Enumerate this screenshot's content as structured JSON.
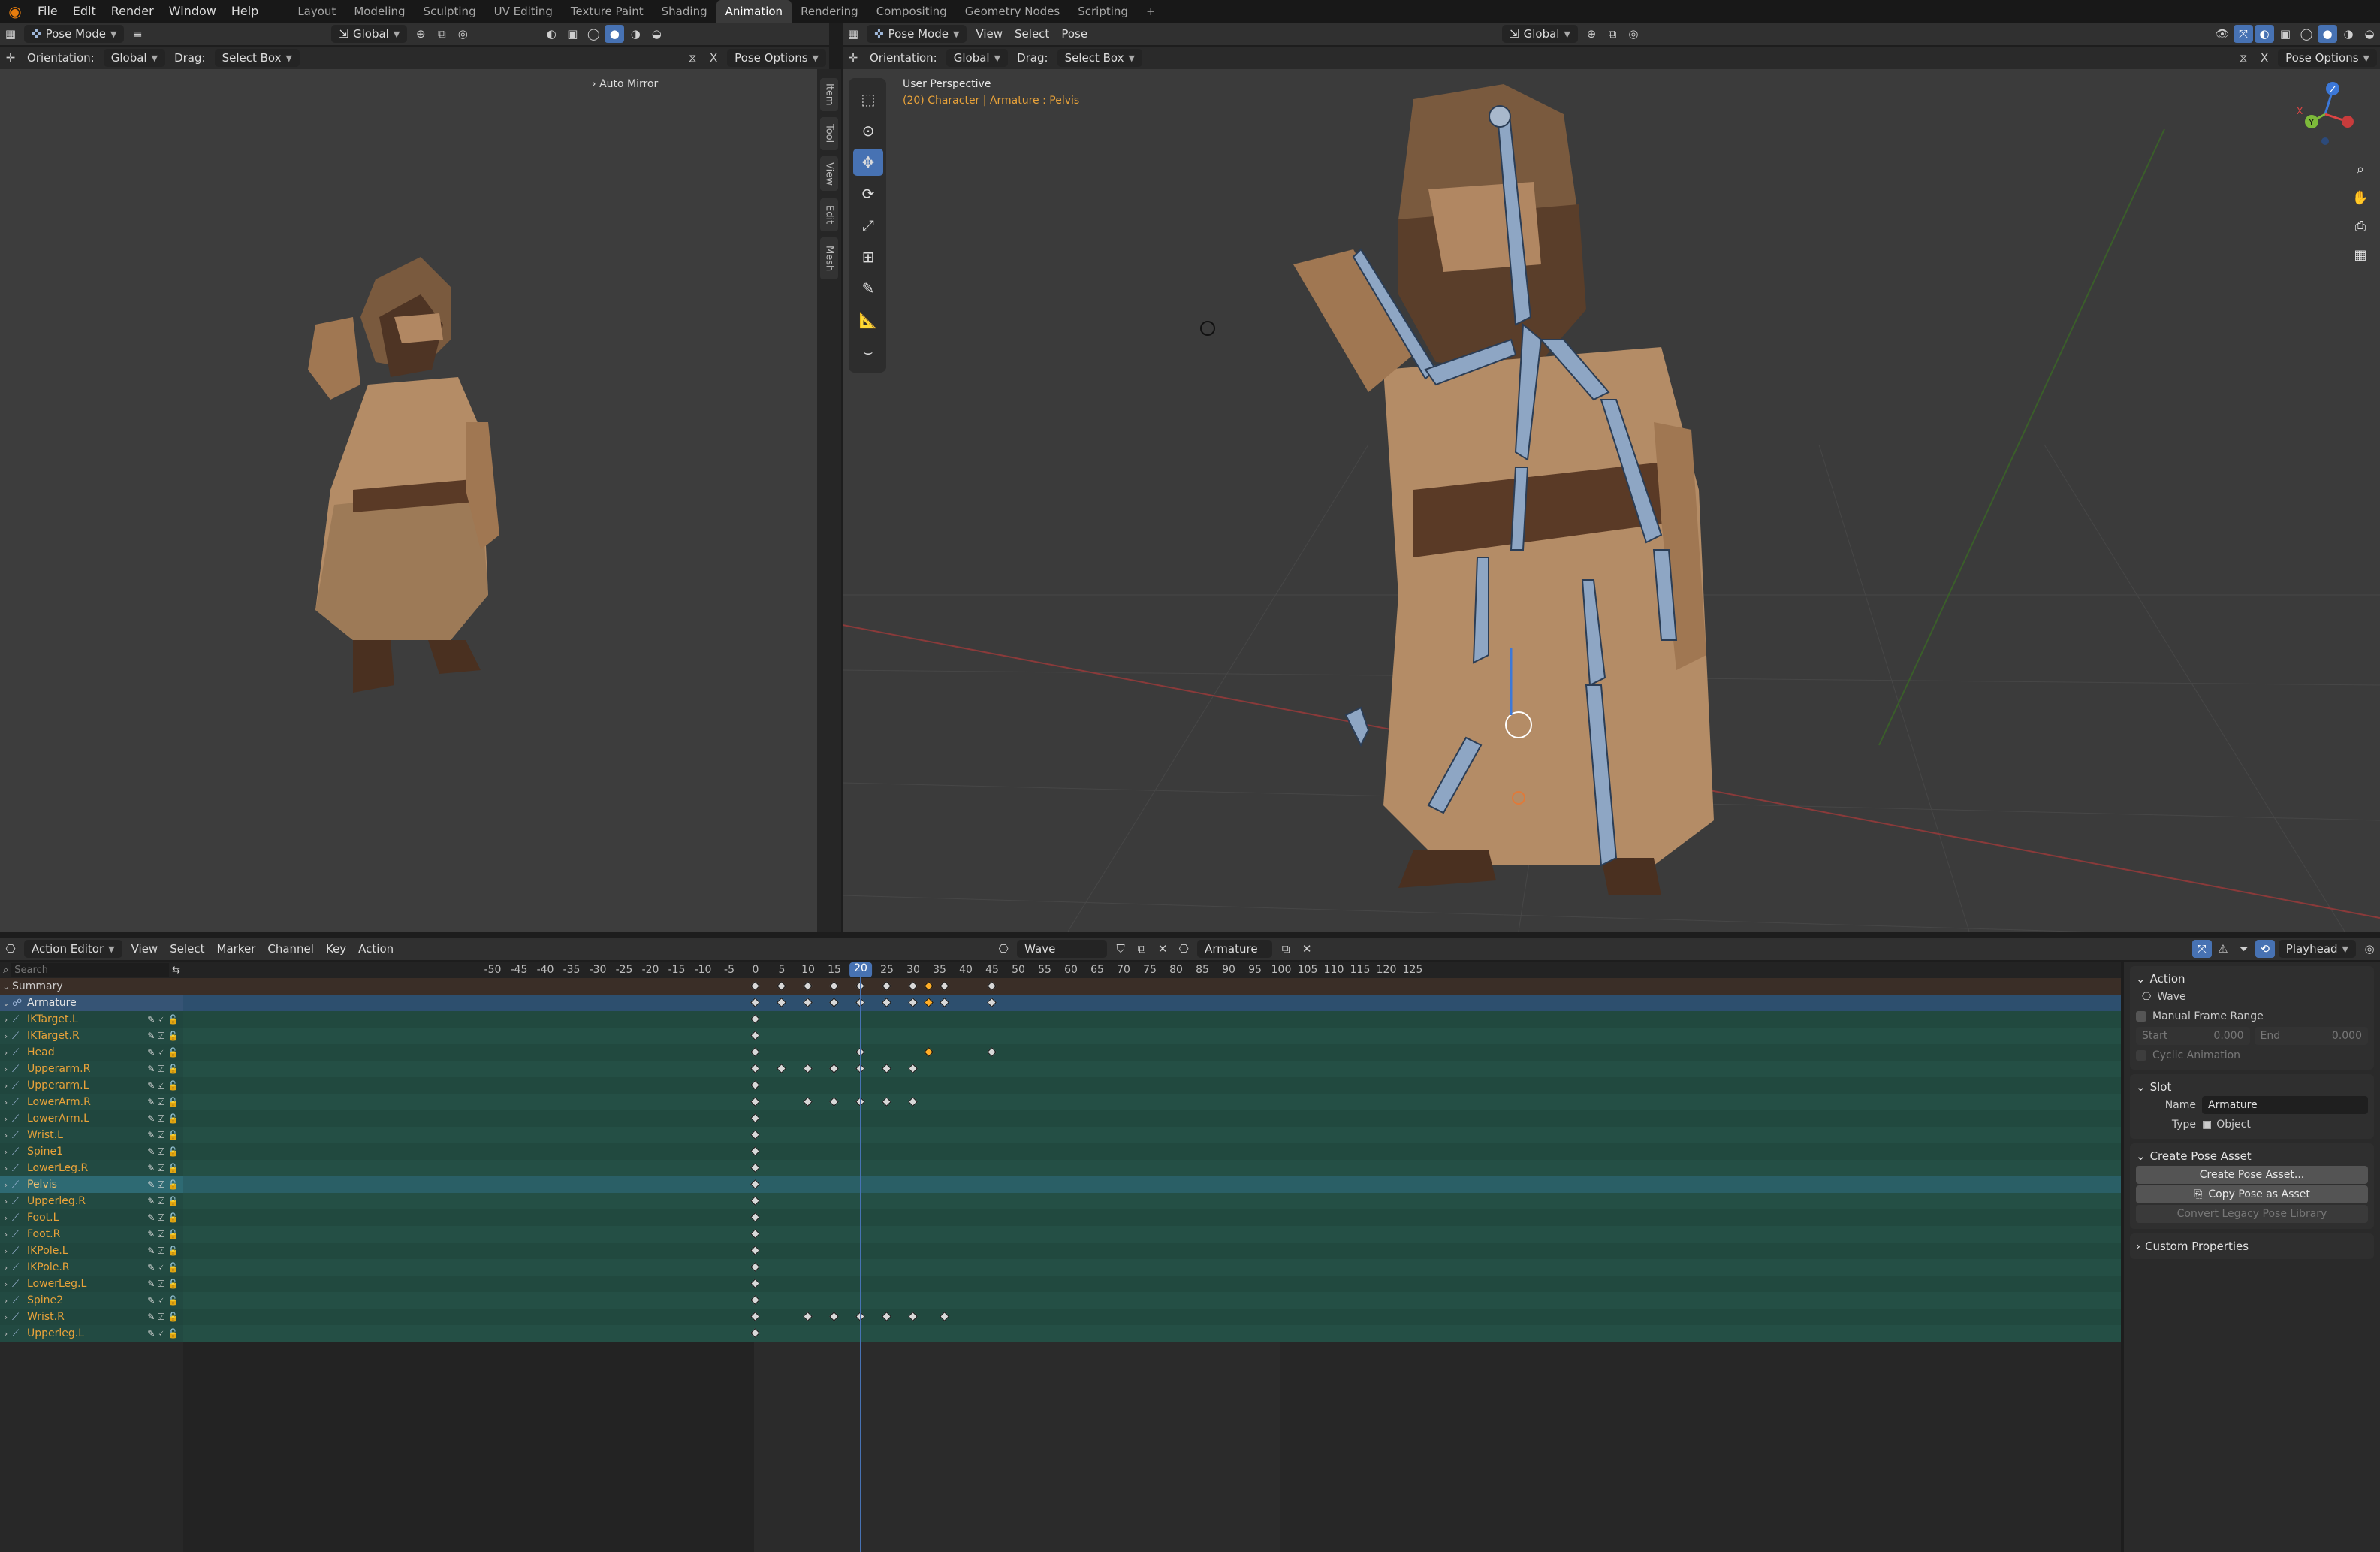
{
  "topbar": {
    "menus": [
      "File",
      "Edit",
      "Render",
      "Window",
      "Help"
    ],
    "workspaces": [
      "Layout",
      "Modeling",
      "Sculpting",
      "UV Editing",
      "Texture Paint",
      "Shading",
      "Animation",
      "Rendering",
      "Compositing",
      "Geometry Nodes",
      "Scripting"
    ],
    "active_workspace": "Animation",
    "add": "+"
  },
  "left_view": {
    "mode": "Pose Mode",
    "orientation_label": "Orientation:",
    "orientation": "Global",
    "transform": "Global",
    "drag_label": "Drag:",
    "drag": "Select Box",
    "pose_options": "Pose Options",
    "auto_mirror": "Auto Mirror",
    "x_label": "X"
  },
  "right_view": {
    "mode": "Pose Mode",
    "menus": [
      "View",
      "Select",
      "Pose"
    ],
    "transform": "Global",
    "orientation_label": "Orientation:",
    "orientation": "Global",
    "drag_label": "Drag:",
    "drag": "Select Box",
    "pose_options": "Pose Options",
    "x_label": "X",
    "perspective": "User Perspective",
    "context": "(20) Character | Armature : Pelvis"
  },
  "npanel_tabs": [
    "Item",
    "Tool",
    "View",
    "Edit",
    "Mesh"
  ],
  "gizmo": {
    "z": "Z",
    "y": "Y",
    "x": "X"
  },
  "dopesheet": {
    "editor": "Action Editor",
    "menus": [
      "View",
      "Select",
      "Marker",
      "Channel",
      "Key",
      "Action"
    ],
    "action": "Wave",
    "slot": "Armature",
    "playhead": "Playhead",
    "search_placeholder": "Search",
    "current_frame": 20,
    "ruler": [
      -50,
      -45,
      -40,
      -35,
      -30,
      -25,
      -20,
      -15,
      -10,
      -5,
      0,
      5,
      10,
      15,
      20,
      25,
      30,
      35,
      40,
      45,
      50,
      55,
      60,
      65,
      70,
      75,
      80,
      85,
      90,
      95,
      100,
      105,
      110,
      115,
      120,
      125
    ],
    "summary": "Summary",
    "armature": "Armature",
    "channels": [
      {
        "name": "IKTarget.L",
        "keys": [
          0
        ]
      },
      {
        "name": "IKTarget.R",
        "keys": [
          0
        ]
      },
      {
        "name": "Head",
        "keys": [
          0,
          20,
          33,
          45
        ],
        "selected": [
          33
        ]
      },
      {
        "name": "Upperarm.R",
        "keys": [
          0,
          5,
          10,
          15,
          20,
          25,
          30
        ]
      },
      {
        "name": "Upperarm.L",
        "keys": [
          0
        ]
      },
      {
        "name": "LowerArm.R",
        "keys": [
          0,
          10,
          15,
          20,
          25,
          30
        ]
      },
      {
        "name": "LowerArm.L",
        "keys": [
          0
        ]
      },
      {
        "name": "Wrist.L",
        "keys": [
          0
        ]
      },
      {
        "name": "Spine1",
        "keys": [
          0
        ]
      },
      {
        "name": "LowerLeg.R",
        "keys": [
          0
        ]
      },
      {
        "name": "Pelvis",
        "keys": [
          0
        ],
        "active": true
      },
      {
        "name": "Upperleg.R",
        "keys": [
          0
        ]
      },
      {
        "name": "Foot.L",
        "keys": [
          0
        ]
      },
      {
        "name": "Foot.R",
        "keys": [
          0
        ]
      },
      {
        "name": "IKPole.L",
        "keys": [
          0
        ]
      },
      {
        "name": "IKPole.R",
        "keys": [
          0
        ]
      },
      {
        "name": "LowerLeg.L",
        "keys": [
          0
        ]
      },
      {
        "name": "Spine2",
        "keys": [
          0
        ]
      },
      {
        "name": "Wrist.R",
        "keys": [
          0,
          10,
          15,
          20,
          25,
          30,
          36
        ]
      },
      {
        "name": "Upperleg.L",
        "keys": [
          0
        ]
      }
    ],
    "summary_keys": [
      0,
      5,
      10,
      15,
      20,
      25,
      30,
      33,
      36,
      45
    ],
    "summary_selected": [
      33
    ]
  },
  "props": {
    "action_title": "Action",
    "action_name": "Wave",
    "manual_range": "Manual Frame Range",
    "start_label": "Start",
    "start": "0.000",
    "end_label": "End",
    "end": "0.000",
    "cyclic": "Cyclic Animation",
    "slot_title": "Slot",
    "name_label": "Name",
    "name": "Armature",
    "type_label": "Type",
    "type": "Object",
    "pose_asset_title": "Create Pose Asset",
    "create_pose": "Create Pose Asset...",
    "copy_pose": "Copy Pose as Asset",
    "convert": "Convert Legacy Pose Library",
    "custom_props": "Custom Properties"
  }
}
